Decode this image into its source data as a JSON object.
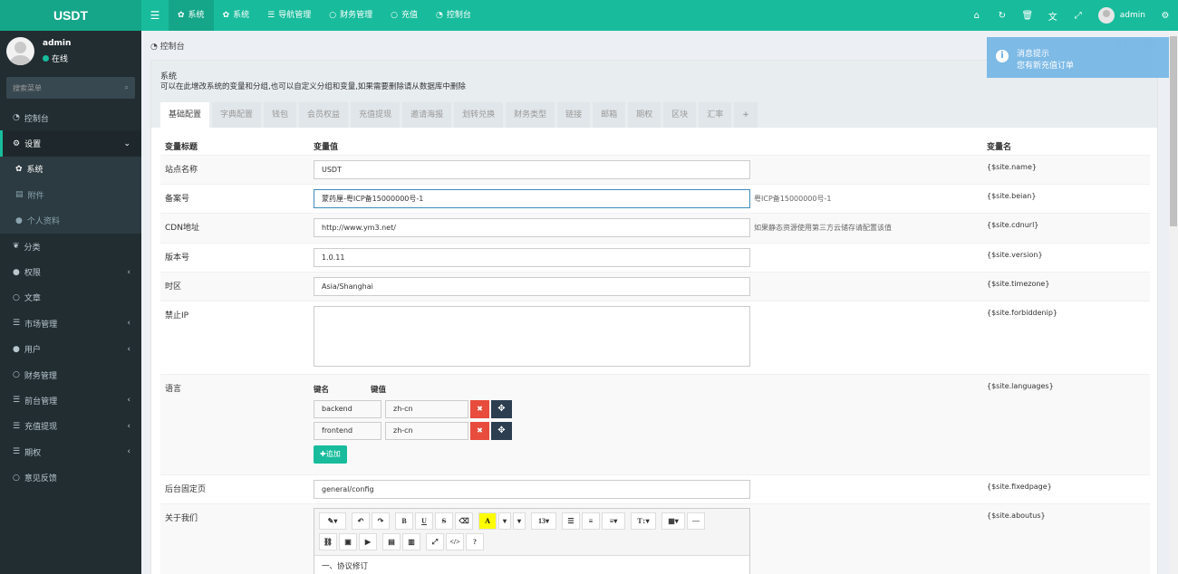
{
  "app": {
    "logo": "USDT"
  },
  "topnav": {
    "toggle_icon": "bars-icon",
    "items": [
      {
        "label": "系统",
        "icon": "gear-icon"
      },
      {
        "label": "系统",
        "icon": "gear-icon"
      },
      {
        "label": "导航管理",
        "icon": "list-icon"
      },
      {
        "label": "财务管理",
        "icon": "circle-icon"
      },
      {
        "label": "充值",
        "icon": "circle-icon"
      },
      {
        "label": "控制台",
        "icon": "dashboard-icon"
      }
    ],
    "user": "admin"
  },
  "sidebar": {
    "user": {
      "name": "admin",
      "status": "在线"
    },
    "search_placeholder": "搜索菜单",
    "items": [
      {
        "label": "控制台",
        "icon": "dashboard-icon"
      },
      {
        "label": "设置",
        "icon": "gears-icon"
      },
      {
        "label": "系统",
        "icon": "gear-icon"
      },
      {
        "label": "附件",
        "icon": "file-icon"
      },
      {
        "label": "个人资料",
        "icon": "user-icon"
      },
      {
        "label": "分类",
        "icon": "leaf-icon"
      },
      {
        "label": "权限",
        "icon": "users-icon"
      },
      {
        "label": "文章",
        "icon": "circle-icon"
      },
      {
        "label": "市场管理",
        "icon": "list-icon"
      },
      {
        "label": "用户",
        "icon": "user-icon"
      },
      {
        "label": "财务管理",
        "icon": "circle-icon"
      },
      {
        "label": "前台管理",
        "icon": "list-icon"
      },
      {
        "label": "充值提现",
        "icon": "list-icon"
      },
      {
        "label": "期权",
        "icon": "list-icon"
      },
      {
        "label": "意见反馈",
        "icon": "circle-icon"
      }
    ]
  },
  "breadcrumb": "控制台",
  "panel": {
    "title": "系统",
    "desc": "可以在此增改系统的变量和分组,也可以自定义分组和变量,如果需要删除请从数据库中删除",
    "tabs": [
      "基础配置",
      "字典配置",
      "钱包",
      "会员权益",
      "充值提现",
      "邀请海报",
      "划转兑换",
      "财务类型",
      "链接",
      "邮箱",
      "期权",
      "区块",
      "汇率",
      "+"
    ]
  },
  "table": {
    "headers": {
      "title": "变量标题",
      "value": "变量值",
      "name": "变量名"
    },
    "rows": [
      {
        "title": "站点名称",
        "value": "USDT",
        "tip": "",
        "name": "{$site.name}"
      },
      {
        "title": "备案号",
        "value": "蒙药厘-粤ICP备15000000号-1",
        "tip": "粤ICP备15000000号-1",
        "name": "{$site.beian}"
      },
      {
        "title": "CDN地址",
        "value": "http://www.ym3.net/",
        "tip": "如果静态资源使用第三方云储存请配置该值",
        "name": "{$site.cdnurl}"
      },
      {
        "title": "版本号",
        "value": "1.0.11",
        "tip": "",
        "name": "{$site.version}"
      },
      {
        "title": "时区",
        "value": "Asia/Shanghai",
        "tip": "",
        "name": "{$site.timezone}"
      },
      {
        "title": "禁止IP",
        "value": "",
        "tip": "",
        "name": "{$site.forbiddenip}"
      },
      {
        "title": "语言",
        "name": "{$site.languages}"
      },
      {
        "title": "后台固定页",
        "value": "general/config",
        "tip": "",
        "name": "{$site.fixedpage}"
      },
      {
        "title": "关于我们",
        "name": "{$site.aboutus}"
      }
    ],
    "languages": {
      "key_header": "键名",
      "val_header": "键值",
      "pairs": [
        {
          "key": "backend",
          "value": "zh-cn"
        },
        {
          "key": "frontend",
          "value": "zh-cn"
        }
      ],
      "add_label": "追加"
    },
    "editor": {
      "font_size": "13",
      "content": "一、协议修订"
    }
  },
  "toast": {
    "title": "消息提示",
    "message": "您有新充值订单"
  },
  "ghost_links": [
    "设置",
    "系统"
  ]
}
